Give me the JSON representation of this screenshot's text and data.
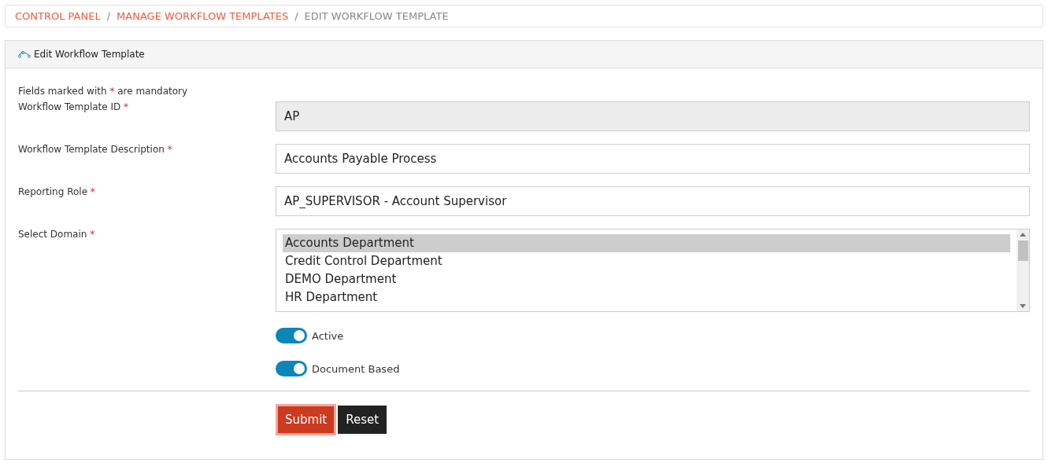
{
  "breadcrumb_separator": "/",
  "breadcrumb": [
    {
      "label": "CONTROL PANEL",
      "current": false
    },
    {
      "label": "MANAGE WORKFLOW TEMPLATES",
      "current": false
    },
    {
      "label": "EDIT WORKFLOW TEMPLATE",
      "current": true
    }
  ],
  "panel": {
    "title": "Edit Workflow Template"
  },
  "note": {
    "before": "Fields marked with",
    "mark": "*",
    "after": "are mandatory"
  },
  "fields": [
    {
      "kind": "text",
      "label": "Workflow Template ID",
      "required": true,
      "value": "AP",
      "disabled": true
    },
    {
      "kind": "text",
      "label": "Workflow Template Description",
      "required": true,
      "value": "Accounts Payable Process",
      "disabled": false
    },
    {
      "kind": "text",
      "label": "Reporting Role",
      "required": true,
      "value": "AP_SUPERVISOR - Account Supervisor",
      "disabled": false
    },
    {
      "kind": "list",
      "label": "Select Domain",
      "required": true,
      "options": [
        {
          "label": "Accounts Department",
          "selected": true
        },
        {
          "label": "Credit Control Department",
          "selected": false
        },
        {
          "label": "DEMO Department",
          "selected": false
        },
        {
          "label": "HR Department",
          "selected": false
        }
      ]
    }
  ],
  "toggles": [
    {
      "label": "Active",
      "on": true
    },
    {
      "label": "Document Based",
      "on": true
    }
  ],
  "buttons": [
    {
      "label": "Submit",
      "kind": "primary"
    },
    {
      "label": "Reset",
      "kind": "secondary"
    }
  ]
}
